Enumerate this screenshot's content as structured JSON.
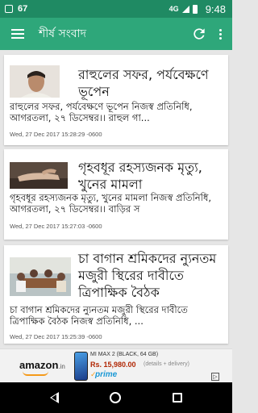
{
  "status_bar": {
    "notification_count": "67",
    "network": "4G",
    "time": "9:48"
  },
  "app_bar": {
    "title": "শীর্ষ সংবাদ",
    "icons": [
      "menu-icon",
      "refresh-icon",
      "more-vert-icon"
    ]
  },
  "articles": [
    {
      "headline": "রাহুলের সফর, পর্যবেক্ষণে ভূপেন",
      "summary": "রাহুলের সফর, পর্যবেক্ষণে ভূপেন   নিজস্ব প্রতিনিধি, আগরতলা, ২৭ ডিসেম্বর।। রাহুল গা...",
      "date": "Wed, 27 Dec 2017 15:28:29 -0600",
      "image": "rahul-portrait"
    },
    {
      "headline": "গৃহবধূর রহস্যজনক মৃত্যু, খুনের মামলা",
      "summary": "গৃহবধূর রহস্যজনক মৃত্যু, খুনের মামলা   নিজস্ব প্রতিনিধি, আগরতলা, ২৭ ডিসেম্বর।। বাড়ির স",
      "date": "Wed, 27 Dec 2017 15:27:03 -0600",
      "image": "body-hand-photo"
    },
    {
      "headline": "চা বাগান শ্রমিকদের ন্যুনতম মজুরী স্থিরের দাবীতে ত্রিপাক্ষিক বৈঠক",
      "summary": "চা বাগান শ্রমিকদের ন্যুনতম মজুরী স্থিরের দাবীতে ত্রিপাক্ষিক বৈঠক   নিজস্ব প্রতিনিধি, ...",
      "date": "Wed, 27 Dec 2017 15:25:39 -0600",
      "image": "meeting-photo"
    }
  ],
  "ad": {
    "brand": "amazon",
    "brand_suffix": ".in",
    "product": "MI MAX 2 (BLACK, 64 GB)",
    "price": "Rs. 15,980.00",
    "details": "(details + delivery)",
    "prime": "prime"
  },
  "colors": {
    "status_bar": "#1f8a63",
    "app_bar": "#2ea77a",
    "background": "#e6e6e6"
  }
}
